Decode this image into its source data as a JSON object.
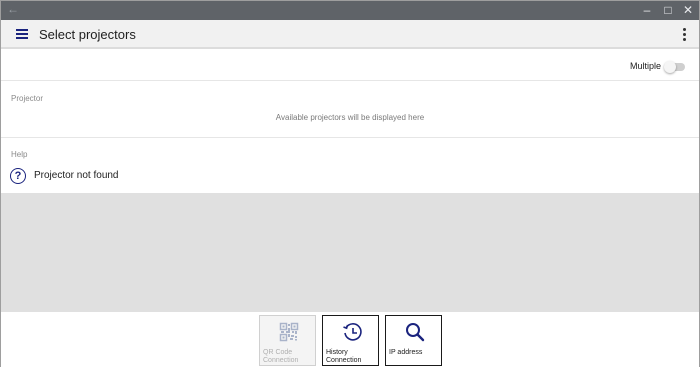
{
  "window": {
    "back_glyph": "←",
    "minimize_glyph": "–",
    "maximize_glyph": "□",
    "close_glyph": "✕"
  },
  "appbar": {
    "title": "Select projectors",
    "menu_icon": "hamburger-menu-icon",
    "overflow_icon": "more-vert-icon"
  },
  "multiple": {
    "label": "Multiple",
    "enabled": false
  },
  "projector": {
    "heading": "Projector",
    "empty_text": "Available projectors will be displayed here"
  },
  "help": {
    "heading": "Help",
    "item_label": "Projector not found",
    "item_icon": "question-circle-icon",
    "item_glyph": "?"
  },
  "bottom_buttons": [
    {
      "label": "QR Code\nConnection",
      "icon": "qr-code-icon",
      "enabled": false
    },
    {
      "label": "History\nConnection",
      "icon": "history-clock-icon",
      "enabled": true
    },
    {
      "label": "IP address",
      "icon": "search-icon",
      "enabled": true
    }
  ],
  "colors": {
    "accent": "#1a237e",
    "titlebar": "#5f6368",
    "appbar": "#f1f1f1",
    "empty_area": "#e0e0e0"
  }
}
